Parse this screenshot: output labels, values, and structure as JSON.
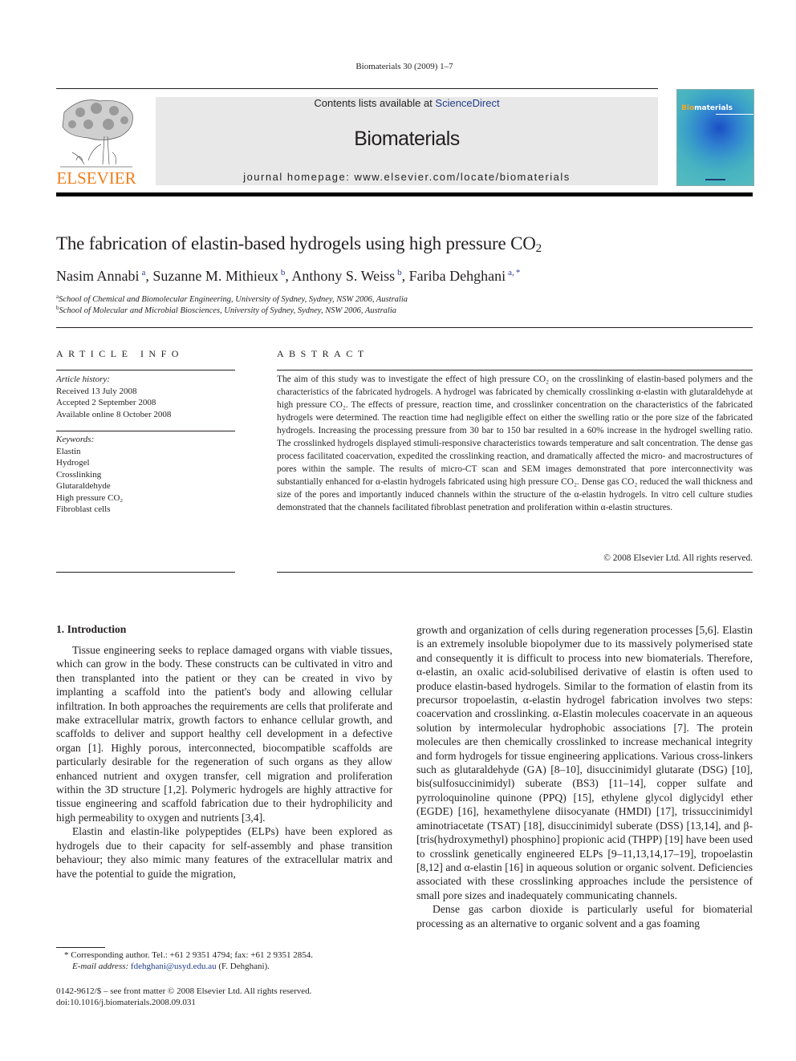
{
  "running_head": "Biomaterials 30 (2009) 1–7",
  "masthead": {
    "publisher_logo_text": "ELSEVIER",
    "contents_prefix": "Contents lists available at ",
    "contents_link": "ScienceDirect",
    "journal_name": "Biomaterials",
    "homepage": "journal homepage: www.elsevier.com/locate/biomaterials",
    "cover": {
      "title_highlight": "Bio",
      "title_rest": "materials"
    }
  },
  "article": {
    "title_main": "The fabrication of elastin-based hydrogels using high pressure CO",
    "title_sub": "2",
    "authors": [
      {
        "name": "Nasim Annabi",
        "affil": "a"
      },
      {
        "name": "Suzanne M. Mithieux",
        "affil": "b"
      },
      {
        "name": "Anthony S. Weiss",
        "affil": "b"
      },
      {
        "name": "Fariba Dehghani",
        "affil": "a, *"
      }
    ],
    "affiliations": [
      {
        "key": "a",
        "text": "School of Chemical and Biomolecular Engineering, University of Sydney, Sydney, NSW 2006, Australia"
      },
      {
        "key": "b",
        "text": "School of Molecular and Microbial Biosciences, University of Sydney, Sydney, NSW 2006, Australia"
      }
    ]
  },
  "article_info": {
    "heading": "ARTICLE INFO",
    "history_label": "Article history:",
    "history": [
      "Received 13 July 2008",
      "Accepted 2 September 2008",
      "Available online 8 October 2008"
    ],
    "keywords_label": "Keywords:",
    "keywords": [
      "Elastin",
      "Hydrogel",
      "Crosslinking",
      "Glutaraldehyde",
      "High pressure CO₂",
      "Fibroblast cells"
    ]
  },
  "abstract": {
    "heading": "ABSTRACT",
    "text": "The aim of this study was to investigate the effect of high pressure CO₂ on the crosslinking of elastin-based polymers and the characteristics of the fabricated hydrogels. A hydrogel was fabricated by chemically crosslinking α-elastin with glutaraldehyde at high pressure CO₂. The effects of pressure, reaction time, and crosslinker concentration on the characteristics of the fabricated hydrogels were determined. The reaction time had negligible effect on either the swelling ratio or the pore size of the fabricated hydrogels. Increasing the processing pressure from 30 bar to 150 bar resulted in a 60% increase in the hydrogel swelling ratio. The crosslinked hydrogels displayed stimuli-responsive characteristics towards temperature and salt concentration. The dense gas process facilitated coacervation, expedited the crosslinking reaction, and dramatically affected the micro- and macrostructures of pores within the sample. The results of micro-CT scan and SEM images demonstrated that pore interconnectivity was substantially enhanced for α-elastin hydrogels fabricated using high pressure CO₂. Dense gas CO₂ reduced the wall thickness and size of the pores and importantly induced channels within the structure of the α-elastin hydrogels. In vitro cell culture studies demonstrated that the channels facilitated fibroblast penetration and proliferation within α-elastin structures.",
    "copyright": "© 2008 Elsevier Ltd. All rights reserved."
  },
  "body": {
    "section_heading": "1.  Introduction",
    "left_paragraphs": [
      "Tissue engineering seeks to replace damaged organs with viable tissues, which can grow in the body. These constructs can be cultivated in vitro and then transplanted into the patient or they can be created in vivo by implanting a scaffold into the patient's body and allowing cellular infiltration. In both approaches the requirements are cells that proliferate and make extracellular matrix, growth factors to enhance cellular growth, and scaffolds to deliver and support healthy cell development in a defective organ [1]. Highly porous, interconnected, biocompatible scaffolds are particularly desirable for the regeneration of such organs as they allow enhanced nutrient and oxygen transfer, cell migration and proliferation within the 3D structure [1,2]. Polymeric hydrogels are highly attractive for tissue engineering and scaffold fabrication due to their hydrophilicity and high permeability to oxygen and nutrients [3,4].",
      "Elastin and elastin-like polypeptides (ELPs) have been explored as hydrogels due to their capacity for self-assembly and phase transition behaviour; they also mimic many features of the extracellular matrix and have the potential to guide the migration,"
    ],
    "right_paragraphs": [
      "growth and organization of cells during regeneration processes [5,6]. Elastin is an extremely insoluble biopolymer due to its massively polymerised state and consequently it is difficult to process into new biomaterials. Therefore, α-elastin, an oxalic acid-solubilised derivative of elastin is often used to produce elastin-based hydrogels. Similar to the formation of elastin from its precursor tropoelastin, α-elastin hydrogel fabrication involves two steps: coacervation and crosslinking. α-Elastin molecules coacervate in an aqueous solution by intermolecular hydrophobic associations [7]. The protein molecules are then chemically crosslinked to increase mechanical integrity and form hydrogels for tissue engineering applications. Various cross-linkers such as glutaraldehyde (GA) [8–10], disuccinimidyl glutarate (DSG) [10], bis(sulfosuccinimidyl) suberate (BS3) [11–14], copper sulfate and pyrroloquinoline quinone (PPQ) [15], ethylene glycol diglycidyl ether (EGDE) [16], hexamethylene diisocyanate (HMDI) [17], trissuccinimidyl aminotriacetate (TSAT) [18], disuccinimidyl suberate (DSS) [13,14], and β-[tris(hydroxymethyl) phosphino] propionic acid (THPP) [19] have been used to crosslink genetically engineered ELPs [9–11,13,14,17–19], tropoelastin [8,12] and α-elastin [16] in aqueous solution or organic solvent. Deficiencies associated with these crosslinking approaches include the persistence of small pore sizes and inadequately communicating channels.",
      "Dense gas carbon dioxide is particularly useful for biomaterial processing as an alternative to organic solvent and a gas foaming"
    ]
  },
  "footnotes": {
    "corresponding": "*  Corresponding author. Tel.: +61 2 9351 4794; fax: +61 2 9351 2854.",
    "email_label": "E-mail address: ",
    "email": "fdehghani@usyd.edu.au",
    "email_suffix": " (F. Dehghani).",
    "issn": "0142-9612/$ – see front matter © 2008 Elsevier Ltd. All rights reserved.",
    "doi": "doi:10.1016/j.biomaterials.2008.09.031"
  }
}
